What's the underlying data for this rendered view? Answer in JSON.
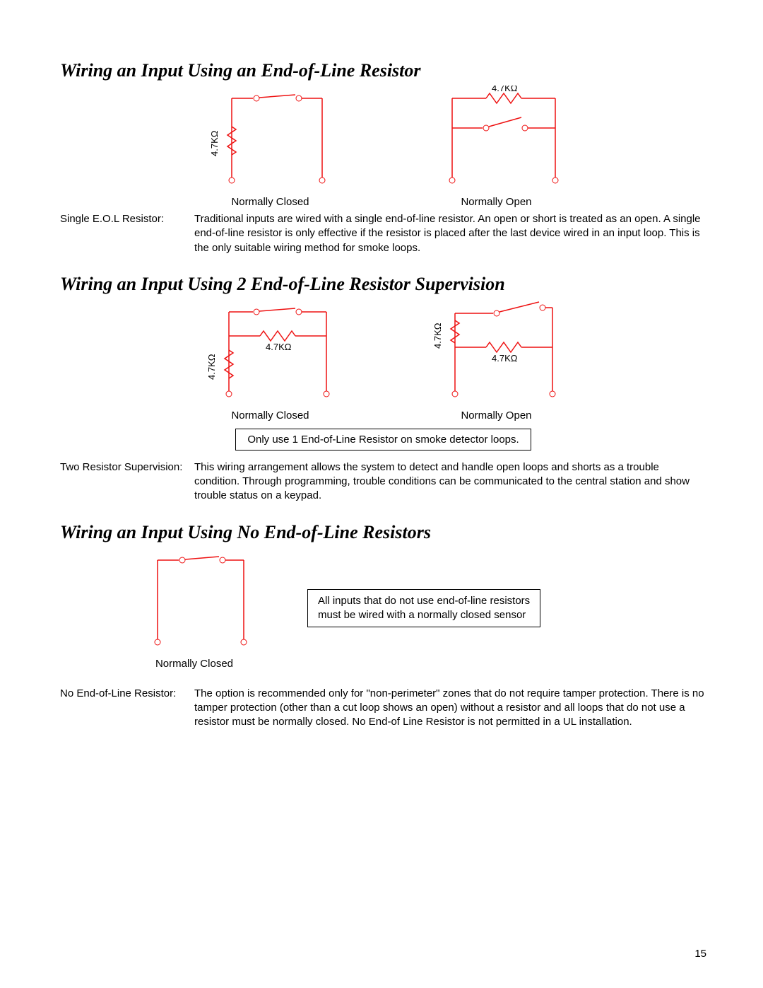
{
  "section1": {
    "title": "Wiring an Input Using an End-of-Line Resistor",
    "diagram_left_caption": "Normally Closed",
    "diagram_right_caption": "Normally Open",
    "resistor_label": "4.7KΩ",
    "desc_label": "Single E.O.L Resistor:",
    "desc_body": "Traditional inputs are wired with a single end-of-line resistor.  An open or short is treated as an open.  A single end-of-line resistor is only effective if the resistor is placed after the last device wired in an input loop.  This is the only suitable wiring method for smoke loops."
  },
  "section2": {
    "title": "Wiring an Input Using 2 End-of-Line Resistor Supervision",
    "diagram_left_caption": "Normally Closed",
    "diagram_right_caption": "Normally Open",
    "resistor_label": "4.7KΩ",
    "note": "Only use 1 End-of-Line Resistor on smoke detector loops.",
    "desc_label": "Two Resistor Supervision:",
    "desc_body": "This wiring arrangement allows the system to detect and handle open loops and shorts as a trouble condition.  Through programming, trouble conditions can be communicated to the central station and show trouble status on a keypad."
  },
  "section3": {
    "title": "Wiring an Input Using No End-of-Line Resistors",
    "diagram_caption": "Normally Closed",
    "note_line1": "All inputs that do not use end-of-line resistors",
    "note_line2": "must be wired with a normally closed sensor",
    "desc_label": "No End-of-Line Resistor:",
    "desc_body": "The option is recommended only for \"non-perimeter\" zones that do not require tamper protection.  There is no tamper protection (other than a cut loop shows an open) without a resistor and all loops that do not use a resistor must be normally closed.  No End-of Line Resistor is not permitted in a UL installation."
  },
  "page_number": "15"
}
